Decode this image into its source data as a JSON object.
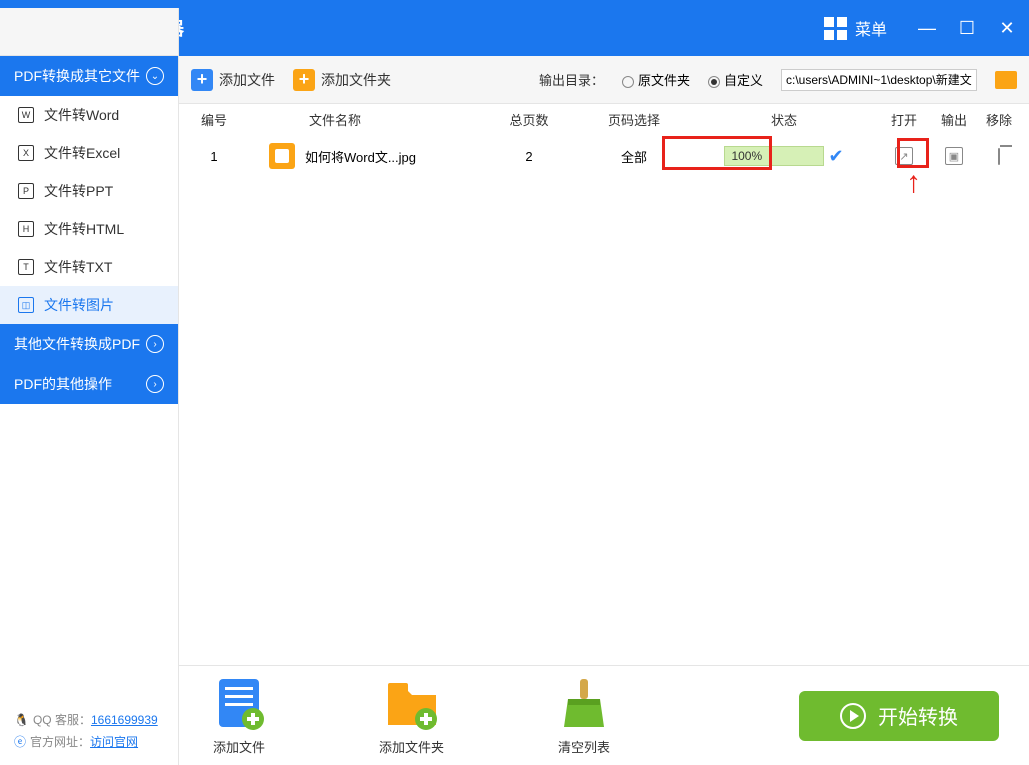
{
  "app": {
    "title": "迅米PDF转换器",
    "menu_label": "菜单"
  },
  "toolbar": {
    "add_file": "添加文件",
    "add_folder": "添加文件夹",
    "output_label": "输出目录：",
    "opt_original": "原文件夹",
    "opt_custom": "自定义",
    "path": "c:\\users\\ADMINI~1\\desktop\\新建文"
  },
  "sidebar": {
    "cat1": "PDF转换成其它文件",
    "items": [
      {
        "label": "文件转Word",
        "glyph": "W"
      },
      {
        "label": "文件转Excel",
        "glyph": "X"
      },
      {
        "label": "文件转PPT",
        "glyph": "P"
      },
      {
        "label": "文件转HTML",
        "glyph": "H"
      },
      {
        "label": "文件转TXT",
        "glyph": "T"
      },
      {
        "label": "文件转图片",
        "glyph": "◫"
      }
    ],
    "cat2": "其他文件转换成PDF",
    "cat3": "PDF的其他操作"
  },
  "footer": {
    "qq_label": "QQ 客服：",
    "qq_num": "1661699939",
    "site_label": "官方网址：",
    "site_link": "访问官网"
  },
  "table": {
    "headers": {
      "num": "编号",
      "name": "文件名称",
      "pages": "总页数",
      "range": "页码选择",
      "status": "状态",
      "open": "打开",
      "output": "输出",
      "remove": "移除"
    },
    "rows": [
      {
        "num": "1",
        "name": "如何将Word文...jpg",
        "pages": "2",
        "range": "全部",
        "progress": "100%"
      }
    ]
  },
  "bottom": {
    "add_file": "添加文件",
    "add_folder": "添加文件夹",
    "clear": "清空列表",
    "start": "开始转换"
  }
}
